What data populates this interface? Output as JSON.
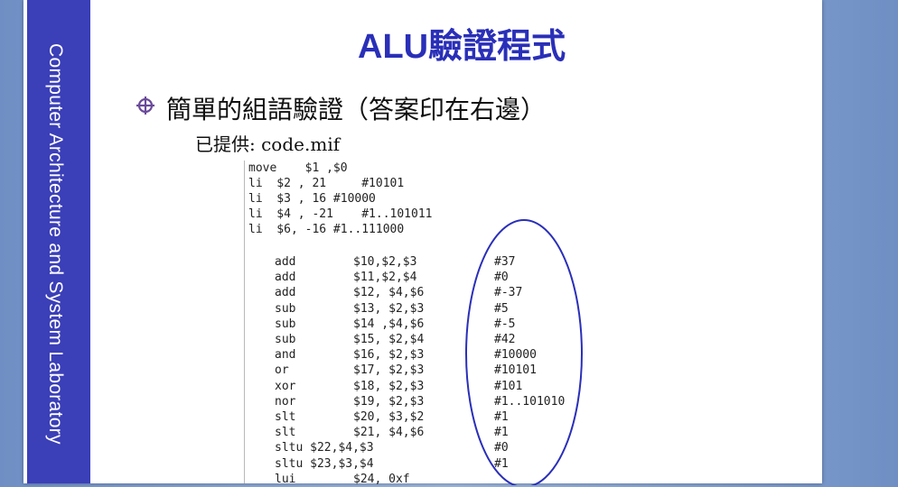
{
  "sidebar": {
    "text": "Computer Architecture and System Laboratory"
  },
  "slide": {
    "title": "ALU驗證程式",
    "bullet": "簡單的組語驗證（答案印在右邊）",
    "provided_label": "已提供:",
    "provided_file": "code.mif"
  },
  "colors": {
    "sidebar": "#3b3fb8",
    "title": "#2a2fb8",
    "bullet_icon": "#6a4a9a",
    "ellipse": "#2a2fb8"
  },
  "icons": {
    "bullet": "crosshair-circle-icon"
  },
  "code": {
    "header_lines": [
      "move    $1 ,$0",
      "li  $2 , 21     #10101",
      "li  $3 , 16 #10000",
      "li  $4 , -21    #1..101011",
      "li  $6, -16 #1..111000"
    ],
    "instructions": [
      {
        "op": "add",
        "args": "$10,$2,$3",
        "ans": "#37"
      },
      {
        "op": "add",
        "args": "$11,$2,$4",
        "ans": "#0"
      },
      {
        "op": "add",
        "args": "$12, $4,$6",
        "ans": "#-37"
      },
      {
        "op": "sub",
        "args": "$13, $2,$3",
        "ans": "#5"
      },
      {
        "op": "sub",
        "args": "$14 ,$4,$6",
        "ans": "#-5"
      },
      {
        "op": "sub",
        "args": "$15, $2,$4",
        "ans": "#42"
      },
      {
        "op": "and",
        "args": "$16, $2,$3",
        "ans": "#10000"
      },
      {
        "op": "or",
        "args": "$17, $2,$3",
        "ans": "#10101"
      },
      {
        "op": "xor",
        "args": "$18, $2,$3",
        "ans": "#101"
      },
      {
        "op": "nor",
        "args": "$19, $2,$3",
        "ans": "#1..101010"
      },
      {
        "op": "slt",
        "args": "$20, $3,$2",
        "ans": "#1"
      },
      {
        "op": "slt",
        "args": "$21, $4,$6",
        "ans": "#1"
      },
      {
        "op": "sltu $22,$4,$3",
        "args": "",
        "ans": "#0"
      },
      {
        "op": "sltu $23,$3,$4",
        "args": "",
        "ans": "#1"
      },
      {
        "op": "lui",
        "args": "$24, 0xf",
        "ans": ""
      }
    ]
  }
}
